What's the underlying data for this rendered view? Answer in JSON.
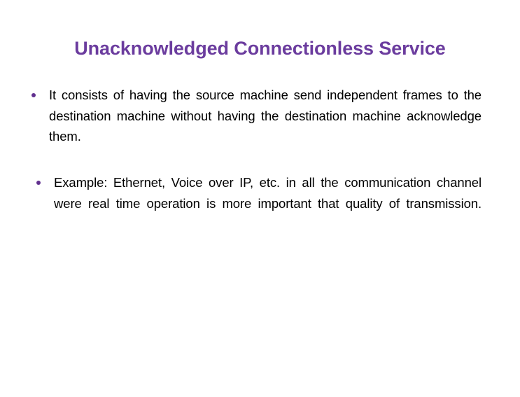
{
  "slide": {
    "background_color": "#FFFFFF",
    "title": "Unacknowledged Connectionless Service",
    "title_color": "#6B3C9E",
    "body_text_color": "#000000",
    "bullet_color": "#61308F",
    "bullets": [
      {
        "marker": "bullet-dot",
        "text": "It consists of having the source machine send independent frames to the destination machine without having the destination machine acknowledge them."
      },
      {
        "marker": "bullet-dot",
        "text": "Example: Ethernet, Voice over IP, etc. in all the communication channel were real time operation is more important that quality of transmission."
      }
    ]
  }
}
